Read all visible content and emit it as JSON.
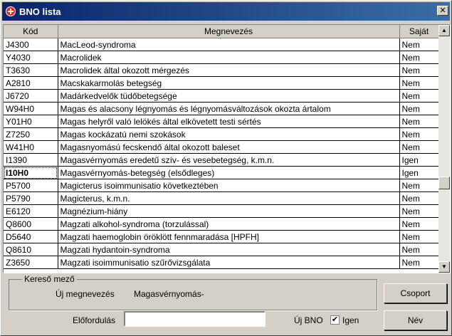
{
  "window": {
    "title": "BNO lista",
    "close_glyph": "✕"
  },
  "table": {
    "headers": {
      "code": "Kód",
      "name": "Megnevezés",
      "own": "Saját"
    },
    "rows": [
      {
        "code": "J4300",
        "name": "MacLeod-syndroma",
        "own": "Nem"
      },
      {
        "code": "Y4030",
        "name": "Macrolidek",
        "own": "Nem"
      },
      {
        "code": "T3630",
        "name": "Macrolidek által okozott mérgezés",
        "own": "Nem"
      },
      {
        "code": "A2810",
        "name": "Macskakarmolás betegség",
        "own": "Nem"
      },
      {
        "code": "J6720",
        "name": "Madárkedvelők tüdőbetegsége",
        "own": "Nem"
      },
      {
        "code": "W94H0",
        "name": "Magas és alacsony légnyomás és légnyomásváltozások okozta ártalom",
        "own": "Nem"
      },
      {
        "code": "Y01H0",
        "name": "Magas helyről való lelökés által elkövetett testi sértés",
        "own": "Nem"
      },
      {
        "code": "Z7250",
        "name": "Magas kockázatú nemi szokások",
        "own": "Nem"
      },
      {
        "code": "W41H0",
        "name": "Magasnyomású fecskendő által okozott baleset",
        "own": "Nem"
      },
      {
        "code": "I1390",
        "name": "Magasvérnyomás eredetű szív- és vesebetegség, k.m.n.",
        "own": "Igen"
      },
      {
        "code": "I10H0",
        "name": "Magasvérnyomás-betegség (elsődleges)",
        "own": "Igen"
      },
      {
        "code": "P5700",
        "name": "Magicterus isoimmunisatio következtében",
        "own": "Nem"
      },
      {
        "code": "P5790",
        "name": "Magicterus, k.m.n.",
        "own": "Nem"
      },
      {
        "code": "E6120",
        "name": "Magnézium-hiány",
        "own": "Nem"
      },
      {
        "code": "Q8600",
        "name": "Magzati alkohol-syndroma (torzulással)",
        "own": "Nem"
      },
      {
        "code": "D5640",
        "name": "Magzati haemoglobin öröklött fennmaradása [HPFH]",
        "own": "Nem"
      },
      {
        "code": "Q8610",
        "name": "Magzati hydantoin-syndroma",
        "own": "Nem"
      },
      {
        "code": "Z3650",
        "name": "Magzati isoimmunisatio szűrővizsgálata",
        "own": "Nem"
      }
    ],
    "selected_index": 10
  },
  "search": {
    "group_label": "Kereső mező",
    "new_name_label": "Új megnevezés",
    "new_name_value": "Magasvérnyomás-",
    "occurrence_label": "Előfordulás",
    "occurrence_value": "",
    "new_bno_label": "Új BNO",
    "new_bno_checked": true,
    "new_bno_check_glyph": "✔",
    "new_bno_value_label": "Igen"
  },
  "buttons": {
    "group": "Csoport",
    "name": "Név"
  },
  "scrollbar": {
    "up_glyph": "▲",
    "down_glyph": "▼"
  }
}
